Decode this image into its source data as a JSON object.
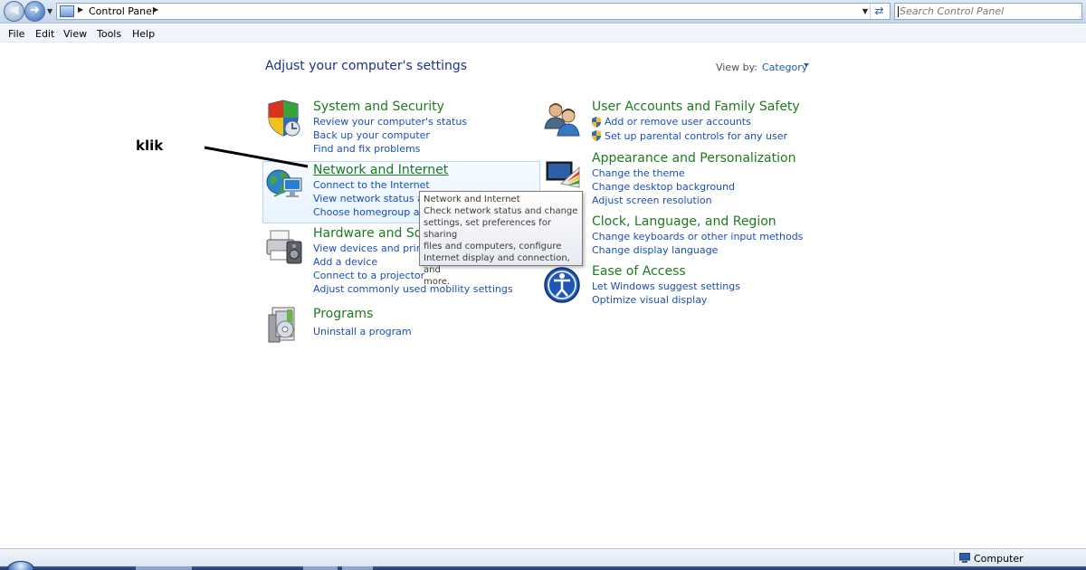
{
  "address_bar": {
    "breadcrumb": "Control Panel",
    "search_placeholder": "Search Control Panel"
  },
  "menu": [
    "File",
    "Edit",
    "View",
    "Tools",
    "Help"
  ],
  "content": {
    "heading": "Adjust your computer's settings",
    "view_by_label": "View by:",
    "view_by_value": "Category"
  },
  "categories": {
    "system_security": {
      "title": "System and Security",
      "links": [
        "Review your computer's status",
        "Back up your computer",
        "Find and fix problems"
      ]
    },
    "network_internet": {
      "title": "Network and Internet",
      "links": [
        "Connect to the Internet",
        "View network status and t",
        "Choose homegroup and"
      ]
    },
    "hardware_sound": {
      "title": "Hardware and Sour",
      "links": [
        "View devices and printers",
        "Add a device",
        "Connect to a projector",
        "Adjust commonly used mobility settings"
      ]
    },
    "programs": {
      "title": "Programs",
      "links": [
        "Uninstall a program"
      ]
    },
    "user_accounts": {
      "title": "User Accounts and Family Safety",
      "links": [
        "Add or remove user accounts",
        "Set up parental controls for any user"
      ]
    },
    "appearance": {
      "title": "Appearance and Personalization",
      "links": [
        "Change the theme",
        "Change desktop background",
        "Adjust screen resolution"
      ]
    },
    "clock_language": {
      "title": "Clock, Language, and Region",
      "links": [
        "Change keyboards or other input methods",
        "Change display language"
      ]
    },
    "ease_access": {
      "title": "Ease of Access",
      "links": [
        "Let Windows suggest settings",
        "Optimize visual display"
      ]
    }
  },
  "tooltip": {
    "title": "Network and Internet",
    "body_lines": [
      "Check network status and change",
      "settings, set preferences for sharing",
      "files and computers, configure",
      "Internet display and connection, and",
      "more."
    ]
  },
  "annotation": {
    "text": "klik"
  },
  "status_bar": {
    "location": "Computer"
  },
  "colors": {
    "category_title": "#1e7a1e",
    "link": "#1a4fb5",
    "heading": "#1e3287"
  },
  "icons": {
    "system_security": "shield-icon",
    "network_internet": "globe-network-icon",
    "hardware_sound": "printer-icon",
    "programs": "programs-box-icon",
    "user_accounts": "users-icon",
    "appearance": "monitor-palette-icon",
    "clock_language": "clock-globe-icon",
    "ease_access": "ease-of-access-icon"
  }
}
